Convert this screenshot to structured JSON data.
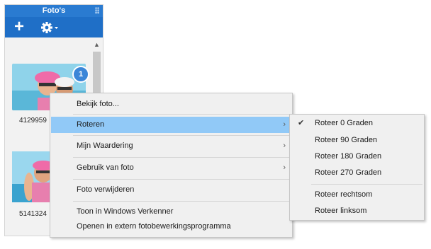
{
  "panel": {
    "title": "Foto's",
    "toolbar": {
      "add_icon": "plus-icon",
      "settings_icon": "gear-icon"
    },
    "photos": [
      {
        "caption": "4129959",
        "badge": "1"
      },
      {
        "caption": "5141324"
      }
    ],
    "accent_color": "#2a7bd1"
  },
  "context_menu": {
    "items": [
      {
        "label": "Bekijk foto..."
      },
      {
        "label": "Roteren",
        "has_submenu": true,
        "active": true
      },
      {
        "label": "Mijn Waardering",
        "has_submenu": true
      },
      {
        "label": "Gebruik van foto",
        "has_submenu": true
      },
      {
        "label": "Foto verwijderen"
      },
      {
        "label": "Toon in Windows Verkenner"
      },
      {
        "label": "Openen in extern fotobewerkingsprogramma"
      }
    ],
    "highlight_color": "#91c9f7"
  },
  "submenu": {
    "items": [
      {
        "label": "Roteer 0 Graden",
        "checked": true
      },
      {
        "label": "Roteer 90 Graden"
      },
      {
        "label": "Roteer 180 Graden"
      },
      {
        "label": "Roteer 270 Graden"
      },
      {
        "label": "Roteer rechtsom"
      },
      {
        "label": "Roteer linksom"
      }
    ]
  }
}
